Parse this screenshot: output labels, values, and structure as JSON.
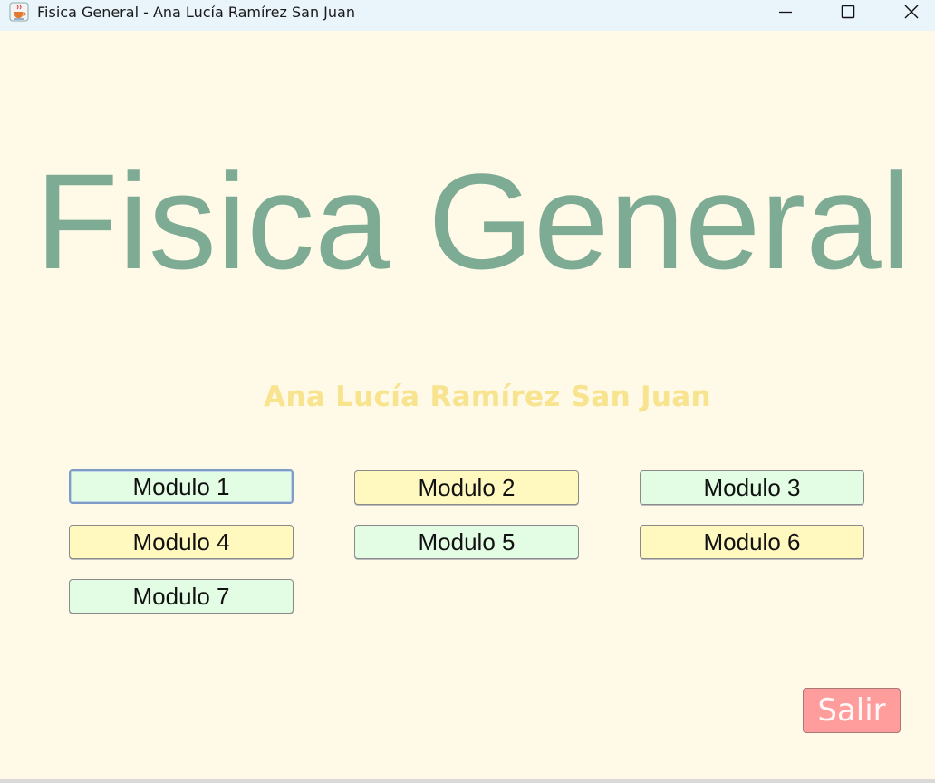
{
  "window": {
    "title": "Fisica General - Ana Lucía Ramírez San Juan",
    "app_icon": "java-coffee-cup-icon",
    "controls": {
      "minimize_icon": "minimize-icon",
      "maximize_icon": "maximize-icon",
      "close_icon": "close-icon"
    }
  },
  "main": {
    "title": "Fisica General",
    "author": "Ana Lucía Ramírez San Juan",
    "modules": [
      {
        "label": "Modulo 1",
        "color": "#e2fde4",
        "focused": true
      },
      {
        "label": "Modulo 2",
        "color": "#fff9c0"
      },
      {
        "label": "Modulo 3",
        "color": "#e2fde4"
      },
      {
        "label": "Modulo 4",
        "color": "#fff9c0"
      },
      {
        "label": "Modulo 5",
        "color": "#e2fde4"
      },
      {
        "label": "Modulo 6",
        "color": "#fff9c0"
      },
      {
        "label": "Modulo 7",
        "color": "#e2fde4"
      }
    ],
    "exit_label": "Salir"
  },
  "colors": {
    "background": "#fff9e8",
    "title": "#7eab94",
    "author": "#f8e38e",
    "exit": "#ff9c9c"
  }
}
